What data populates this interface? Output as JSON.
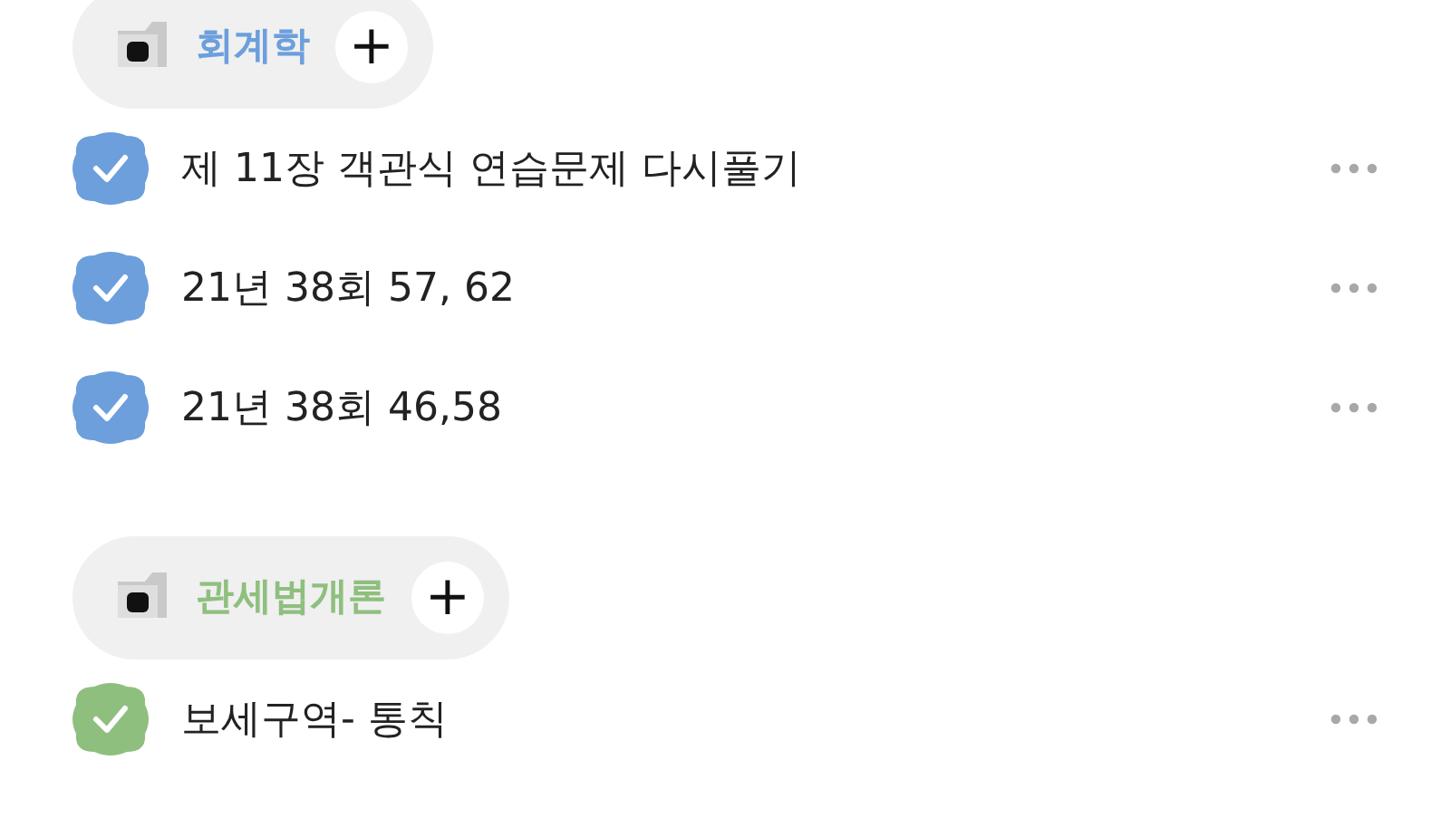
{
  "groups": [
    {
      "title": "회계학",
      "color": "#6c9fdc",
      "add": "+",
      "tasks": [
        {
          "text": "제 11장 객관식 연습문제 다시풀기",
          "checked": true
        },
        {
          "text": "21년 38회 57, 62",
          "checked": true
        },
        {
          "text": "21년 38회 46,58",
          "checked": true
        }
      ]
    },
    {
      "title": "관세법개론",
      "color": "#8fbf7f",
      "add": "+",
      "tasks": [
        {
          "text": "보세구역- 통칙",
          "checked": true
        }
      ]
    }
  ]
}
